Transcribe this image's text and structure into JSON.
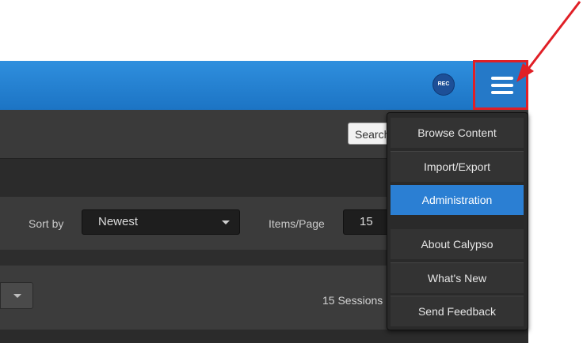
{
  "header": {
    "rec_label": "REC",
    "menu_icon": "hamburger-icon"
  },
  "toolbar": {
    "search_text": "Search"
  },
  "sort": {
    "label": "Sort by",
    "value": "Newest"
  },
  "items_per_page": {
    "label": "Items/Page",
    "value": "15"
  },
  "status": {
    "sessions_text": "15 Sessions"
  },
  "menu": {
    "items": [
      {
        "label": "Browse Content"
      },
      {
        "label": "Import/Export"
      },
      {
        "label": "Administration",
        "active": true
      },
      {
        "label": "About Calypso"
      },
      {
        "label": "What's New"
      },
      {
        "label": "Send Feedback"
      }
    ]
  },
  "colors": {
    "header_blue": "#2584d8",
    "active_item": "#2b7fd3",
    "annotation_red": "#e01f26"
  }
}
